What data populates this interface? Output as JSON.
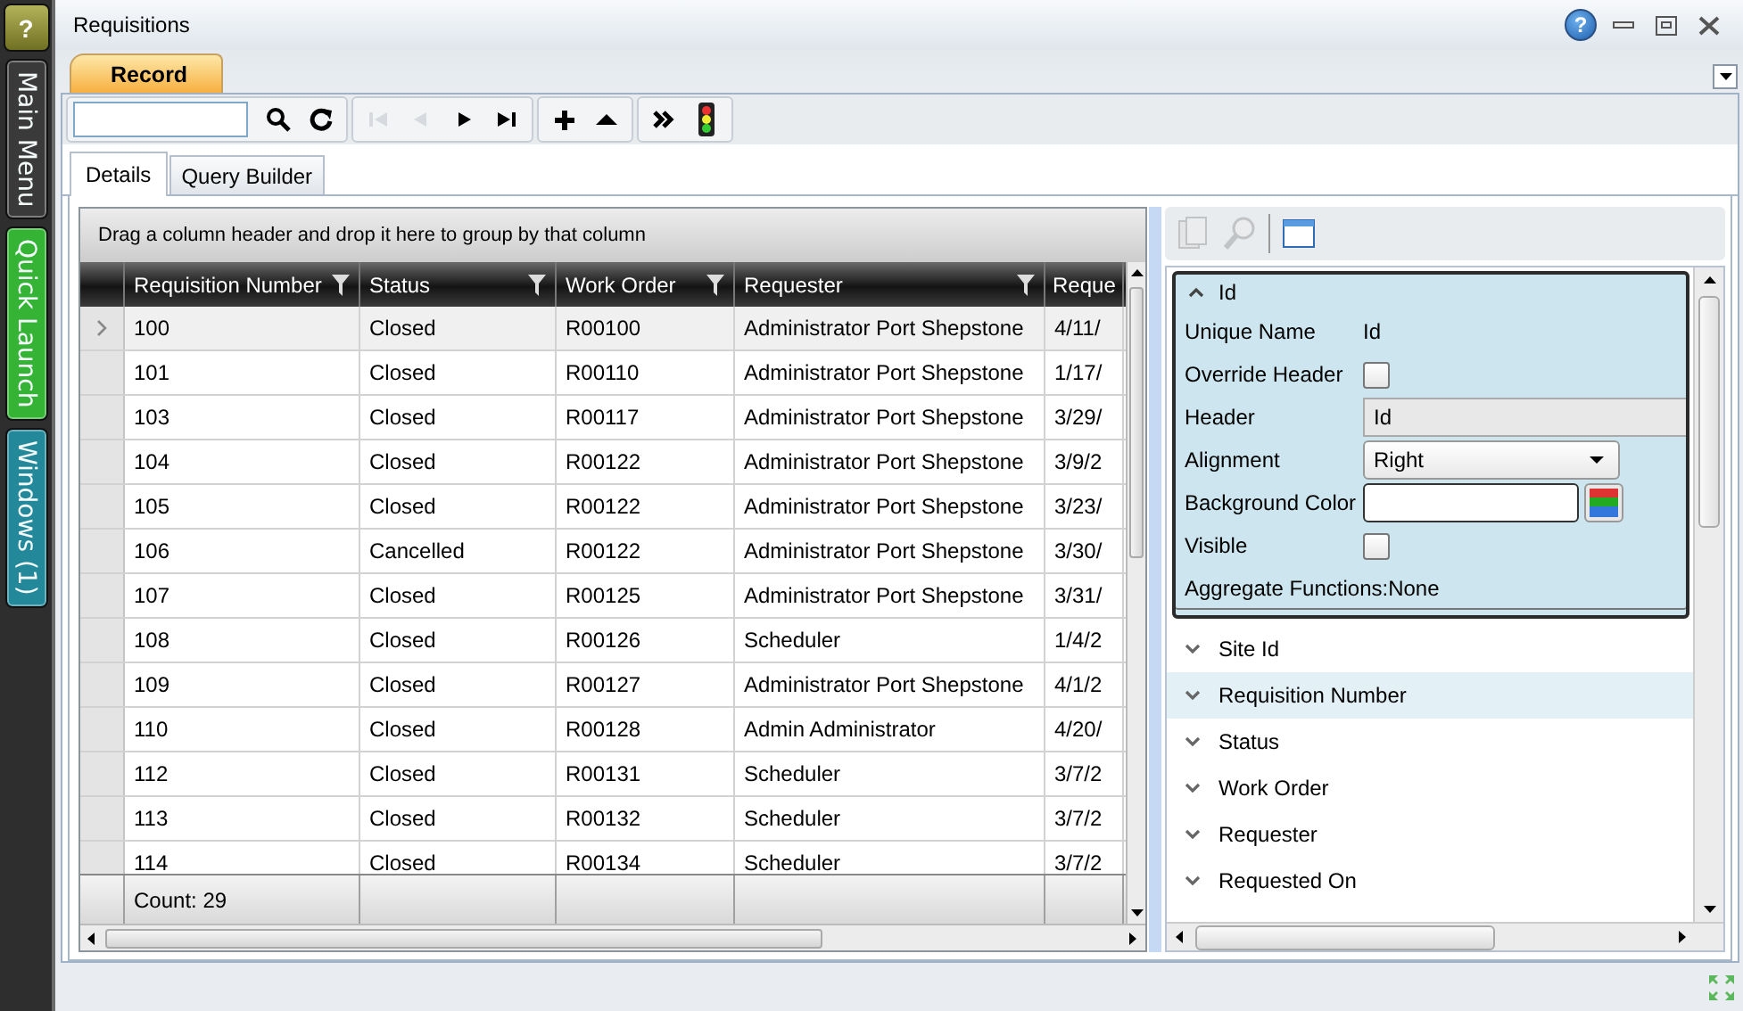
{
  "sidebar": {
    "help_button": "?",
    "items": [
      {
        "label": "Main Menu",
        "color": "#3a3a3a"
      },
      {
        "label": "Quick Launch",
        "color": "#35b335"
      },
      {
        "label": "Windows (1)",
        "color": "#23899a"
      }
    ]
  },
  "window": {
    "title": "Requisitions",
    "help_glyph": "?"
  },
  "record_tabs": [
    {
      "label": "Record",
      "selected": true
    }
  ],
  "toolbar": {
    "buttons": [
      {
        "kind": "search",
        "disabled": false
      },
      {
        "kind": "refresh",
        "disabled": false
      },
      {
        "kind": "first",
        "disabled": true
      },
      {
        "kind": "previous",
        "disabled": true
      },
      {
        "kind": "next",
        "disabled": false
      },
      {
        "kind": "last",
        "disabled": false
      },
      {
        "kind": "add",
        "disabled": false
      },
      {
        "kind": "up",
        "disabled": false
      },
      {
        "kind": "more",
        "disabled": false
      },
      {
        "kind": "traffic_light",
        "disabled": false
      }
    ]
  },
  "view_tabs": [
    {
      "label": "Details",
      "selected": true
    },
    {
      "label": "Query Builder",
      "selected": false
    }
  ],
  "grid": {
    "group_hint": "Drag a column header and drop it here to group by that column",
    "columns": [
      {
        "label": "Requisition Number",
        "filter": true
      },
      {
        "label": "Status",
        "filter": true
      },
      {
        "label": "Work Order",
        "filter": true
      },
      {
        "label": "Requester",
        "filter": true
      },
      {
        "label": "Reque"
      }
    ],
    "rows": [
      {
        "selected": true,
        "cells": [
          "100",
          "Closed",
          "R00100",
          "Administrator Port Shepstone",
          "4/11/"
        ]
      },
      {
        "selected": false,
        "cells": [
          "101",
          "Closed",
          "R00110",
          "Administrator Port Shepstone",
          "1/17/"
        ]
      },
      {
        "selected": false,
        "cells": [
          "103",
          "Closed",
          "R00117",
          "Administrator Port Shepstone",
          "3/29/"
        ]
      },
      {
        "selected": false,
        "cells": [
          "104",
          "Closed",
          "R00122",
          "Administrator Port Shepstone",
          "3/9/2"
        ]
      },
      {
        "selected": false,
        "cells": [
          "105",
          "Closed",
          "R00122",
          "Administrator Port Shepstone",
          "3/23/"
        ]
      },
      {
        "selected": false,
        "cells": [
          "106",
          "Cancelled",
          "R00122",
          "Administrator Port Shepstone",
          "3/30/"
        ]
      },
      {
        "selected": false,
        "cells": [
          "107",
          "Closed",
          "R00125",
          "Administrator Port Shepstone",
          "3/31/"
        ]
      },
      {
        "selected": false,
        "cells": [
          "108",
          "Closed",
          "R00126",
          "Scheduler",
          "1/4/2"
        ]
      },
      {
        "selected": false,
        "cells": [
          "109",
          "Closed",
          "R00127",
          "Administrator Port Shepstone",
          "4/1/2"
        ]
      },
      {
        "selected": false,
        "cells": [
          "110",
          "Closed",
          "R00128",
          "Admin Administrator",
          "4/20/"
        ]
      },
      {
        "selected": false,
        "cells": [
          "112",
          "Closed",
          "R00131",
          "Scheduler",
          "3/7/2"
        ]
      },
      {
        "selected": false,
        "cells": [
          "113",
          "Closed",
          "R00132",
          "Scheduler",
          "3/7/2"
        ]
      },
      {
        "selected": false,
        "cells": [
          "114",
          "Closed",
          "R00134",
          "Scheduler",
          "3/7/2"
        ]
      }
    ],
    "footer": "Count: 29"
  },
  "properties": {
    "tools": [
      {
        "kind": "copy",
        "disabled": true
      },
      {
        "kind": "zoom",
        "disabled": true
      },
      {
        "kind": "window",
        "disabled": false
      }
    ],
    "fields": [
      {
        "label": "Id",
        "expanded": true,
        "selected": false,
        "details": {
          "unique_name_label": "Unique Name",
          "unique_name": "Id",
          "override_label": "Override Header",
          "override_checked": false,
          "header_label": "Header",
          "header_value": "Id",
          "alignment_label": "Alignment",
          "alignment": "Right",
          "background_label": "Background Color",
          "visible_label": "Visible",
          "visible_checked": false,
          "aggregate": "Aggregate Functions:None"
        }
      },
      {
        "label": "Site Id",
        "expanded": false,
        "selected": false
      },
      {
        "label": "Requisition Number",
        "expanded": false,
        "selected": true
      },
      {
        "label": "Status",
        "expanded": false,
        "selected": false
      },
      {
        "label": "Work Order",
        "expanded": false,
        "selected": false
      },
      {
        "label": "Requester",
        "expanded": false,
        "selected": false
      },
      {
        "label": "Requested On",
        "expanded": false,
        "selected": false
      }
    ]
  }
}
